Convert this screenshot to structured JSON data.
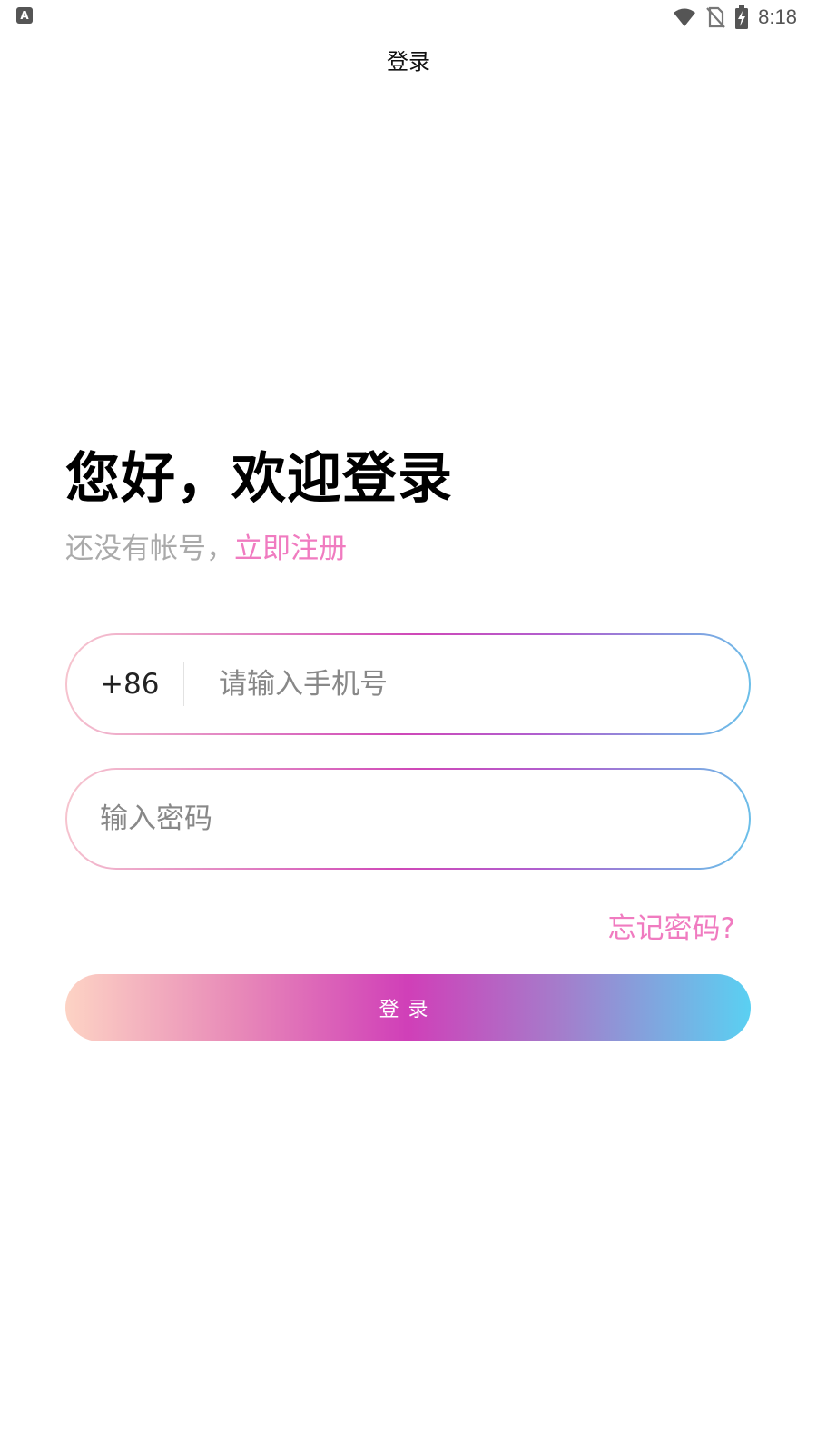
{
  "status_bar": {
    "time": "8:18",
    "notification_icon_letter": "A",
    "icons": [
      "wifi-icon",
      "no-sim-icon",
      "battery-charging-icon"
    ]
  },
  "header": {
    "title": "登录"
  },
  "welcome": {
    "heading": "您好，欢迎登录",
    "no_account_text": "还没有帐号，",
    "register_link": "立即注册"
  },
  "phone_field": {
    "country_code": "+86",
    "value": "",
    "placeholder": "请输入手机号"
  },
  "password_field": {
    "value": "",
    "placeholder": "输入密码"
  },
  "forgot_password": "忘记密码?",
  "login_button": "登录",
  "colors": {
    "accent_pink": "#f07bc0",
    "gradient_start": "#fdd3c4",
    "gradient_mid": "#d03fb8",
    "gradient_end": "#5ad0f2"
  }
}
